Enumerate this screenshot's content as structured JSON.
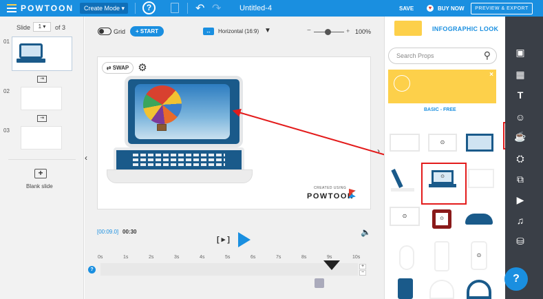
{
  "topbar": {
    "logo": "POWTOON",
    "mode": "Create Mode ▾",
    "doc_title": "Untitled-4",
    "save": "SAVE",
    "buy_now": "BUY NOW",
    "preview": "PREVIEW & EXPORT",
    "help": "?"
  },
  "left": {
    "slide_label": "Slide",
    "slide_current": "1 ▾",
    "slide_total": "of 3",
    "slides": [
      "01",
      "02",
      "03"
    ],
    "blank_slide": "Blank slide"
  },
  "toolbar": {
    "grid": "Grid",
    "start": "+ START",
    "orientation": "Horizontal (16:9)",
    "zoom": "100%",
    "swap": "SWAP"
  },
  "canvas": {
    "watermark_small": "CREATED USING",
    "watermark_logo": "POWTOON"
  },
  "timeline": {
    "current": "[00:09.0]",
    "total": "00:30",
    "ticks": [
      "0s",
      "1s",
      "2s",
      "3s",
      "4s",
      "5s",
      "6s",
      "7s",
      "8s",
      "9s",
      "10s"
    ],
    "play_hint": "[ ▸ ]"
  },
  "right": {
    "look": "INFOGRAPHIC LOOK",
    "search_placeholder": "Search Props",
    "banner_label": "BASIC - FREE"
  },
  "colors": {
    "topbar": "#1a8fe0",
    "accent": "#1a8fe0",
    "banner": "#fdd04a",
    "red": "#e31b1b",
    "rail": "#3a3f47"
  }
}
